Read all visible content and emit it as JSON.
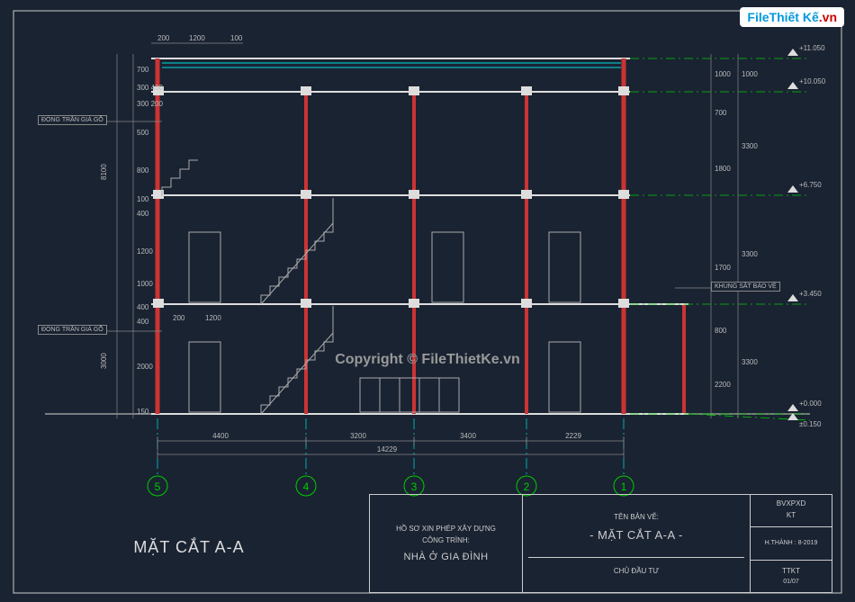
{
  "logo": {
    "p1": "File",
    "p2": "Thiết Kế",
    "p3": ".vn"
  },
  "watermark": "Copyright © FileThietKe.vn",
  "title": "MẶT CẮT A-A",
  "title_block": {
    "col1_sub1": "HỒ SƠ XIN PHÉP XÂY DỰNG",
    "col1_sub2": "CÔNG TRÌNH:",
    "col1_main": "NHÀ Ở GIA ĐÌNH",
    "col2_sub": "TÊN BẢN VẼ:",
    "col2_main": "- MẶT CẮT A-A -",
    "col2_bottom": "CHỦ ĐẦU TƯ",
    "col3_r1a": "BVXPXD",
    "col3_r1b": "KT",
    "col3_r2": "H.THÀNH : 8-2019",
    "col3_r3": "TTKT",
    "col3_r3b": "01/07"
  },
  "labels": {
    "ceiling1": "ĐÓNG TRẦN GIÁ GỖ",
    "ceiling2": "ĐÓNG TRẦN GIÁ GỖ",
    "guard": "KHUNG SẮT BẢO VỆ"
  },
  "dims_h": {
    "top1": "200",
    "top2": "1200",
    "top3": "100",
    "bot1": "4400",
    "bot2": "3200",
    "bot3": "3400",
    "bot4": "2229",
    "total": "14229",
    "b1": "200",
    "b2": "1200"
  },
  "dims_v_left": [
    "700",
    "300 400",
    "300 200",
    "500",
    "800",
    "100",
    "400",
    "1200",
    "1000",
    "400",
    "400",
    "2000",
    "150"
  ],
  "dims_v_left_outer": [
    "8100",
    "3000"
  ],
  "dims_v_right": [
    "1000",
    "700",
    "1800",
    "1700",
    "800",
    "2200"
  ],
  "dims_v_right_outer": [
    "1000",
    "3300",
    "3300",
    "3300"
  ],
  "elevs": [
    "+11.050",
    "+10.050",
    "+6.750",
    "+3.450",
    "+0.000",
    "±0.150"
  ],
  "grids": [
    "5",
    "4",
    "3",
    "2",
    "1"
  ]
}
